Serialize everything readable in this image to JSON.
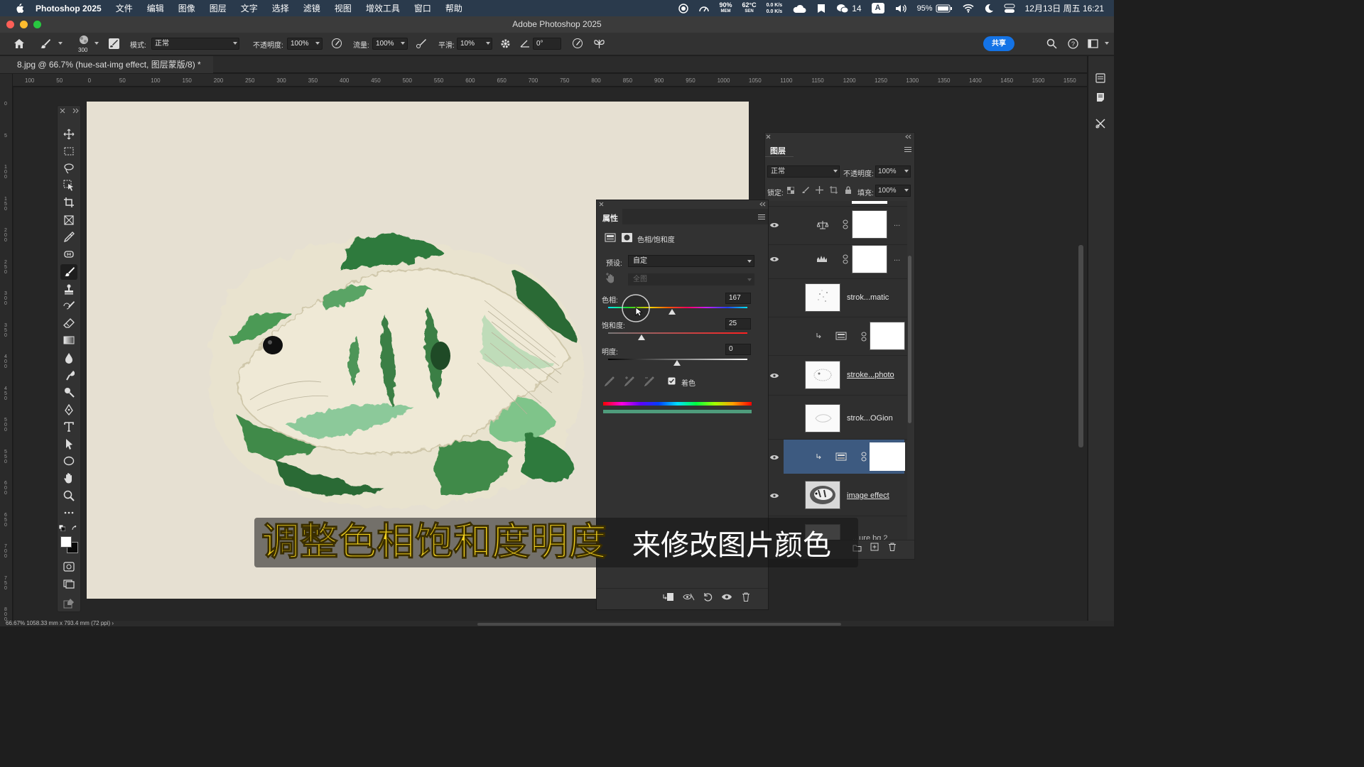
{
  "menubar": {
    "app_name": "Photoshop 2025",
    "items": [
      "文件",
      "编辑",
      "图像",
      "图层",
      "文字",
      "选择",
      "滤镜",
      "视图",
      "增效工具",
      "窗口",
      "帮助"
    ],
    "mem_value": "90%",
    "mem_label": "MEM",
    "sen_value": "62°C",
    "sen_label": "SEN",
    "net_up": "0.0 K/s",
    "net_down": "0.0 K/s",
    "wechat_count": "14",
    "input_method": "A",
    "battery": "95%",
    "datetime": "12月13日 周五 16:21"
  },
  "window": {
    "title": "Adobe Photoshop 2025"
  },
  "options": {
    "brush_size": "300",
    "mode_label": "模式:",
    "mode_value": "正常",
    "opacity_label": "不透明度:",
    "opacity_value": "100%",
    "flow_label": "流量:",
    "flow_value": "100%",
    "smoothing_label": "平滑:",
    "smoothing_value": "10%",
    "angle_value": "0°",
    "share_label": "共享"
  },
  "document": {
    "tab_title": "8.jpg @ 66.7% (hue-sat-img effect, 图层蒙版/8) *"
  },
  "rulers": {
    "h_ticks": [
      "100",
      "50",
      "0",
      "50",
      "100",
      "150",
      "200",
      "250",
      "300",
      "350",
      "400",
      "450",
      "500",
      "550",
      "600",
      "650",
      "700",
      "750",
      "800",
      "850",
      "900",
      "950",
      "1000",
      "1050",
      "1100",
      "1150",
      "1200",
      "1250",
      "1300",
      "1350",
      "1400",
      "1450",
      "1500",
      "1550"
    ],
    "v_ticks": [
      "0",
      "5",
      "1 0 0",
      "1 5 0",
      "2 0 0",
      "2 5 0",
      "3 0 0",
      "3 5 0",
      "4 0 0",
      "4 5 0",
      "5 0 0",
      "5 5 0",
      "6 0 0",
      "6 5 0",
      "7 0 0",
      "7 5 0",
      "8 0 0"
    ]
  },
  "layers_panel": {
    "tab_title": "图层",
    "blend_mode": "正常",
    "opacity_label": "不透明度:",
    "opacity_value": "100%",
    "lock_label": "锁定:",
    "fill_label": "填充:",
    "fill_value": "100%",
    "layers": [
      {
        "name": "",
        "kind": "balance-adjustment",
        "visible": true
      },
      {
        "name": "",
        "kind": "levels-adjustment",
        "visible": true
      },
      {
        "name": "strok...matic",
        "kind": "pixel",
        "visible": false
      },
      {
        "name": "",
        "kind": "hue-sat-clipped",
        "visible": false
      },
      {
        "name": "stroke...photo",
        "kind": "pixel",
        "visible": true
      },
      {
        "name": "strok...OGion",
        "kind": "pixel",
        "visible": false
      },
      {
        "name": "",
        "kind": "hue-sat-clipped-selected",
        "visible": true
      },
      {
        "name": "image effect",
        "kind": "pixel",
        "visible": true
      },
      {
        "name": "...ure bg 2",
        "kind": "pixel",
        "visible": false
      }
    ]
  },
  "properties_panel": {
    "tab_title": "属性",
    "adjustment_name": "色相/饱和度",
    "preset_label": "预设:",
    "preset_value": "自定",
    "channel_value": "全图",
    "hue_label": "色相:",
    "hue_value": "167",
    "saturation_label": "饱和度:",
    "saturation_value": "25",
    "lightness_label": "明度:",
    "lightness_value": "0",
    "colorize_label": "着色",
    "colorize_checked": true
  },
  "subtitle": {
    "highlight": "调整色相饱和度明度",
    "rest": "来修改图片颜色"
  },
  "status": {
    "text": "66.67%   1058.33 mm x 793.4 mm (72 ppi)  ›"
  },
  "colors": {
    "accent": "#1473e6",
    "selected_layer": "#3d5a80",
    "canvas_paper": "#e6e0d2",
    "fish_green_dark": "#2f7a3c",
    "fish_green_light": "#7fc48a",
    "subtitle_yellow": "#f4d21e"
  }
}
